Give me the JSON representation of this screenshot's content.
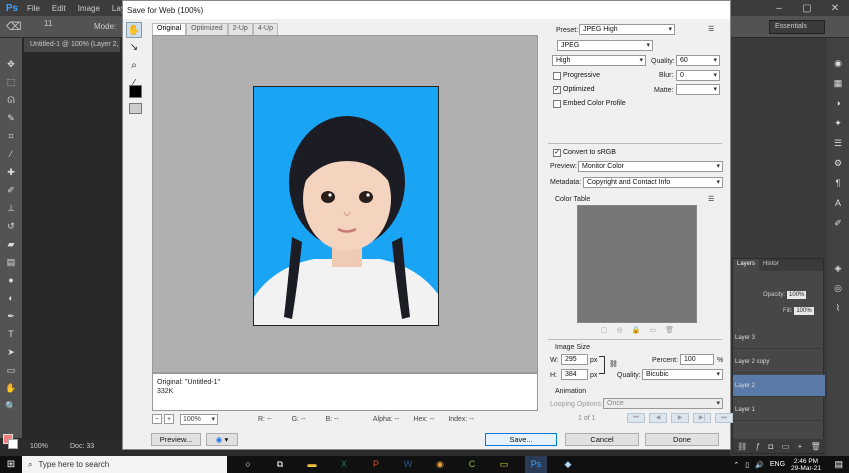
{
  "photoshop": {
    "menu": [
      "File",
      "Edit",
      "Image",
      "Laye"
    ],
    "brush_size": "11",
    "mode_label": "Mode:",
    "workspace": "Essentials",
    "doc_tab": "Untitled-1 @ 100% (Layer 2,",
    "zoom": "100%",
    "doc_label": "Doc: 33",
    "layers": {
      "tabs": [
        "Layers",
        "Histor"
      ],
      "opacity_label": "Opacity:",
      "opacity_value": "100%",
      "fill_label": "Fill:",
      "fill_value": "100%",
      "rows": [
        "Layer 3",
        "Layer 2 copy",
        "Layer 2",
        "Layer 1"
      ],
      "selected": "Layer 2"
    }
  },
  "dialog": {
    "title": "Save for Web (100%)",
    "view_tabs": [
      "Original",
      "Optimized",
      "2-Up",
      "4-Up"
    ],
    "active_tab": "Original",
    "info_line1": "Original: \"Untitled-1\"",
    "info_line2": "332K",
    "zoom": "100%",
    "status": {
      "r": "R: --",
      "g": "G: --",
      "b": "B: --",
      "alpha": "Alpha: --",
      "hex": "Hex: --",
      "index": "Index: --"
    },
    "buttons": {
      "preview": "Preview...",
      "save": "Save...",
      "cancel": "Cancel",
      "done": "Done"
    },
    "settings": {
      "preset_label": "Preset:",
      "preset": "JPEG High",
      "format": "JPEG",
      "quality_level": "High",
      "quality_label": "Quality:",
      "quality": "60",
      "progressive_label": "Progressive",
      "progressive": false,
      "blur_label": "Blur:",
      "blur": "0",
      "optimized_label": "Optimized",
      "optimized": true,
      "matte_label": "Matte:",
      "embed_profile_label": "Embed Color Profile",
      "embed_profile": false,
      "convert_srgb_label": "Convert to sRGB",
      "convert_srgb": true,
      "preview_label": "Preview:",
      "preview_value": "Monitor Color",
      "metadata_label": "Metadata:",
      "metadata_value": "Copyright and Contact Info",
      "color_table_label": "Color Table",
      "image_size_label": "Image Size",
      "w_label": "W:",
      "w_value": "295",
      "h_label": "H:",
      "h_value": "384",
      "px": "px",
      "percent_label": "Percent:",
      "percent_value": "100",
      "percent_sign": "%",
      "quality_resample_label": "Quality:",
      "quality_resample": "Bicubic",
      "animation_label": "Animation",
      "looping_label": "Looping Options:",
      "looping_value": "Once",
      "frame_counter": "1 of 1"
    }
  },
  "taskbar": {
    "search_placeholder": "Type here to search",
    "language": "ENG",
    "time": "2:46 PM",
    "date": "29-Mar-21"
  },
  "colors": {
    "photo_background": "#1aa4f4",
    "selected_layer": "#5a7aa8",
    "save_button_border": "#0078d7"
  }
}
